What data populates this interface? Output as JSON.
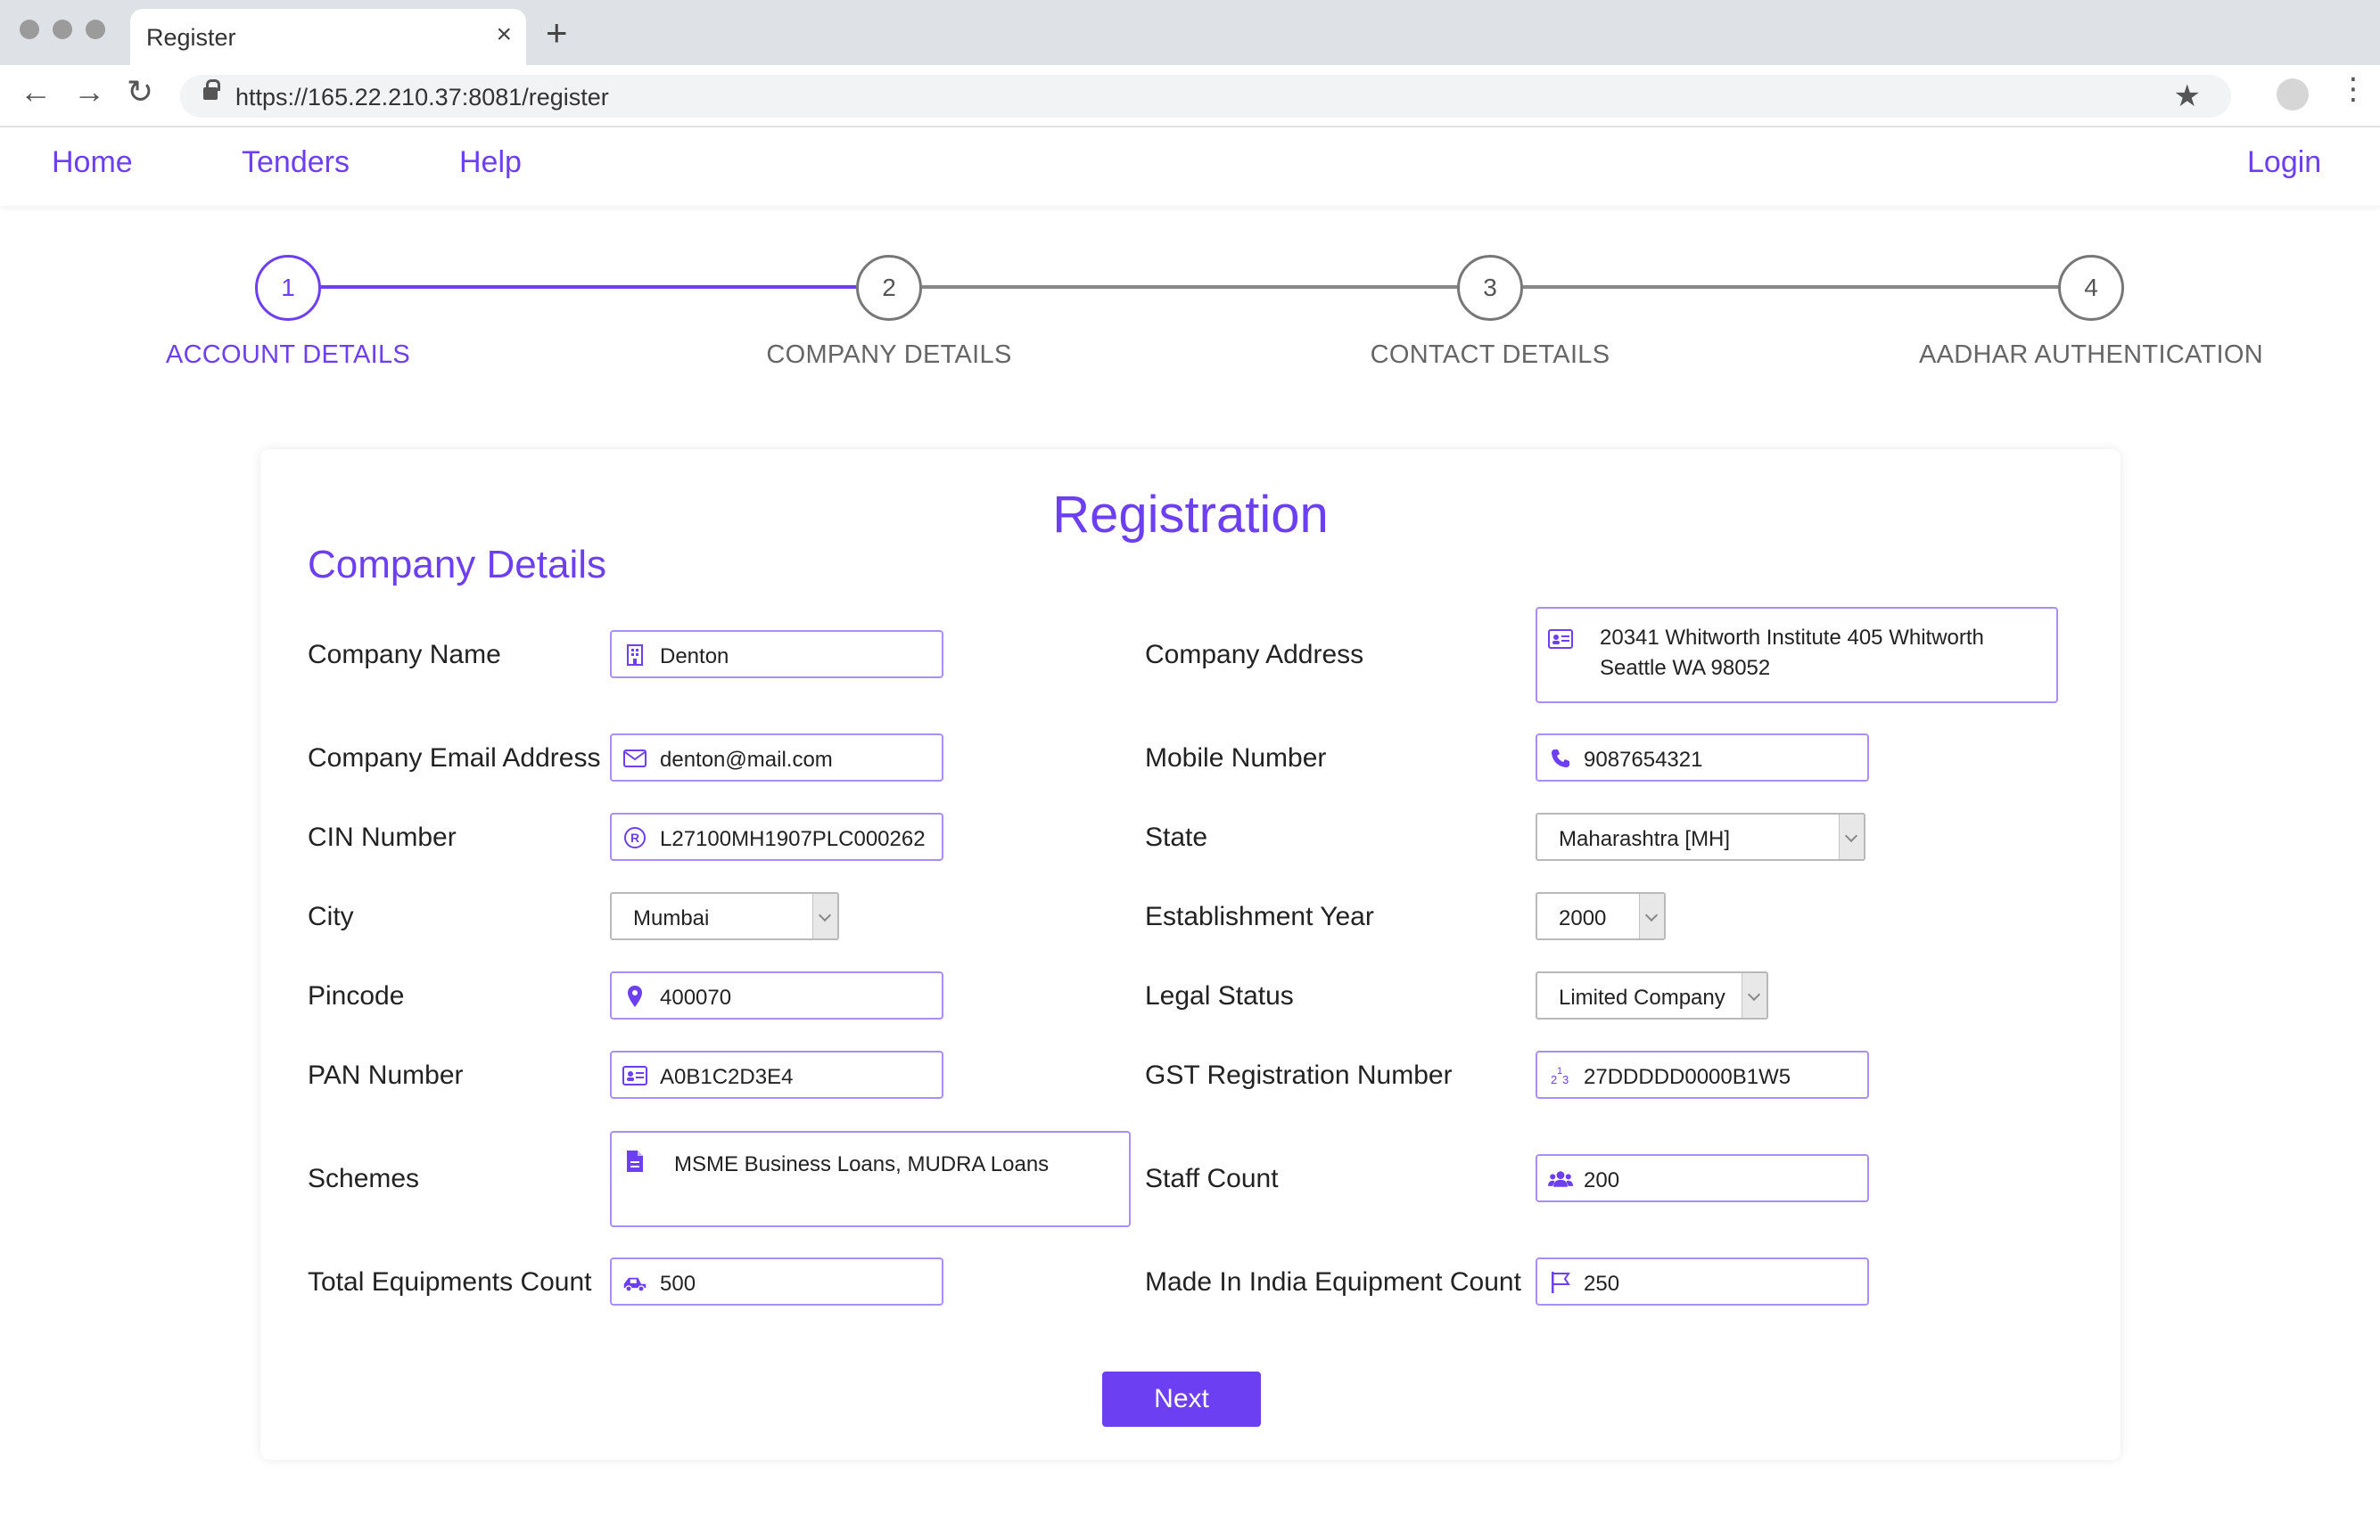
{
  "browser": {
    "tab_title": "Register",
    "tab_close": "×",
    "new_tab": "+",
    "url": "https://165.22.210.37:8081/register",
    "back": "←",
    "forward": "→",
    "reload": "↻",
    "star": "★",
    "menu": "⋮"
  },
  "nav": {
    "home": "Home",
    "tenders": "Tenders",
    "help": "Help",
    "login": "Login"
  },
  "stepper": {
    "accent": "#6c3ff2",
    "steps": [
      {
        "num": "1",
        "label": "ACCOUNT DETAILS",
        "active": true
      },
      {
        "num": "2",
        "label": "COMPANY DETAILS",
        "active": false
      },
      {
        "num": "3",
        "label": "CONTACT DETAILS",
        "active": false
      },
      {
        "num": "4",
        "label": "AADHAR AUTHENTICATION",
        "active": false
      }
    ]
  },
  "form": {
    "title": "Registration",
    "section": "Company Details",
    "company_name": {
      "label": "Company Name",
      "value": "Denton",
      "icon": "building-icon"
    },
    "company_address": {
      "label": "Company Address",
      "value": "20341 Whitworth Institute 405 Whitworth Seattle WA 98052",
      "icon": "address-card-icon"
    },
    "company_email": {
      "label": "Company Email Address",
      "value": "denton@mail.com",
      "icon": "envelope-icon"
    },
    "mobile": {
      "label": "Mobile Number",
      "value": "9087654321",
      "icon": "phone-icon"
    },
    "cin": {
      "label": "CIN Number",
      "value": "L27100MH1907PLC000262",
      "icon": "registered-icon"
    },
    "state": {
      "label": "State",
      "value": "Maharashtra [MH]"
    },
    "city": {
      "label": "City",
      "value": "Mumbai"
    },
    "establishment_year": {
      "label": "Establishment Year",
      "value": "2000"
    },
    "pincode": {
      "label": "Pincode",
      "value": "400070",
      "icon": "map-pin-icon"
    },
    "legal_status": {
      "label": "Legal Status",
      "value": "Limited Company"
    },
    "pan": {
      "label": "PAN Number",
      "value": "A0B1C2D3E4",
      "icon": "id-card-icon"
    },
    "gst": {
      "label": "GST Registration Number",
      "value": "27DDDDD0000B1W5",
      "icon": "numbers-icon"
    },
    "schemes": {
      "label": "Schemes",
      "value": "MSME Business Loans, MUDRA Loans",
      "icon": "document-icon"
    },
    "staff_count": {
      "label": "Staff Count",
      "value": "200",
      "icon": "users-icon"
    },
    "total_equipments": {
      "label": "Total Equipments Count",
      "value": "500",
      "icon": "truck-icon"
    },
    "made_in_india": {
      "label": "Made In India Equipment Count",
      "value": "250",
      "icon": "flag-icon"
    },
    "next_button": "Next"
  }
}
